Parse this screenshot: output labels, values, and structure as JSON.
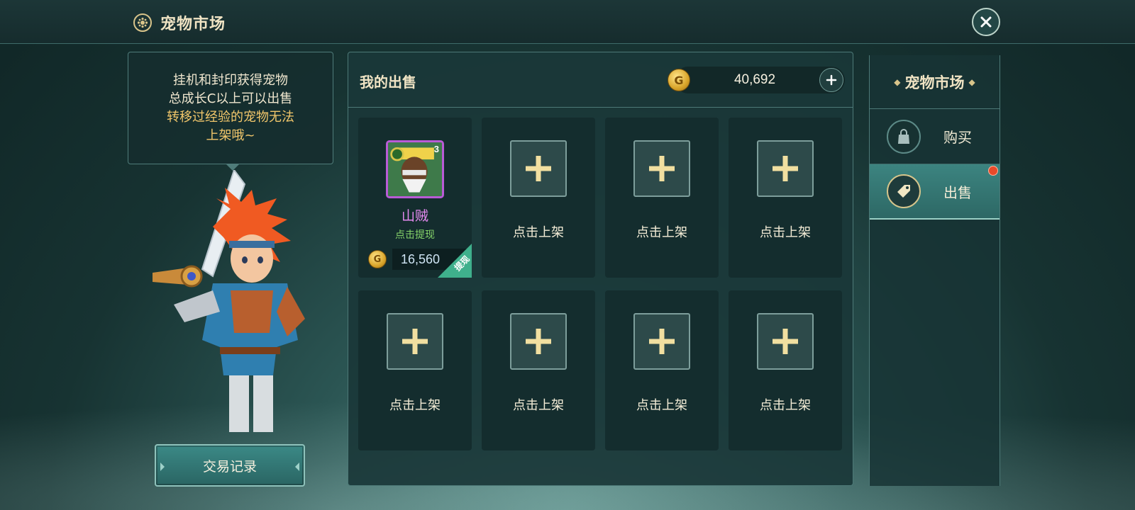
{
  "header": {
    "title": "宠物市场",
    "title_icon": "gear-flower-icon",
    "close_icon": "close-icon"
  },
  "tip": {
    "lines": [
      "挂机和封印获得宠物",
      "总成长C以上可以出售"
    ],
    "highlight_lines": [
      "转移过经验的宠物无法",
      "上架哦~"
    ]
  },
  "history_button": {
    "label": "交易记录"
  },
  "main": {
    "title": "我的出售",
    "currency": {
      "icon": "gold-coin-icon",
      "value": "40,692",
      "add_icon": "plus-icon"
    },
    "sold_slot": {
      "pet_name": "山贼",
      "pet_level": "3",
      "action": "点击提现",
      "price": "16,560",
      "tag": "提现"
    },
    "empty_slot_label": "点击上架",
    "empty_slot_count": 7
  },
  "sidebar": {
    "title": "宠物市场",
    "tabs": [
      {
        "label": "购买",
        "icon": "shopping-bag-icon",
        "active": false,
        "badge": false
      },
      {
        "label": "出售",
        "icon": "price-tag-icon",
        "active": true,
        "badge": true
      }
    ]
  },
  "colors": {
    "accent_gold": "#f2c76b",
    "pet_rarity_purple": "#b95bd6",
    "action_green": "#86d46a",
    "badge_red": "#e84a2a"
  }
}
